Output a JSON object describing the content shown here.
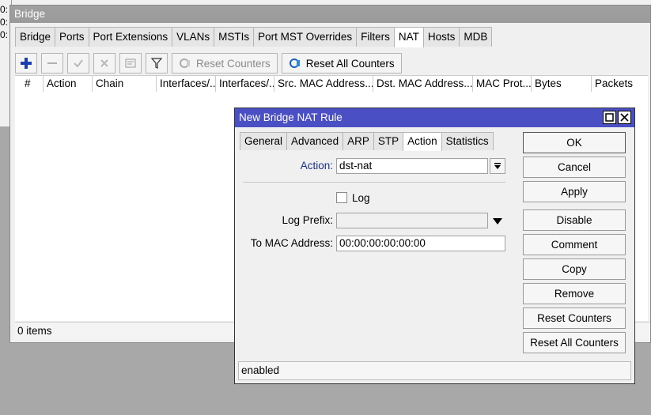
{
  "side_labels": [
    "0:",
    "0:",
    "0:"
  ],
  "bridge": {
    "title": "Bridge",
    "tabs": [
      {
        "label": "Bridge",
        "active": false
      },
      {
        "label": "Ports",
        "active": false
      },
      {
        "label": "Port Extensions",
        "active": false
      },
      {
        "label": "VLANs",
        "active": false
      },
      {
        "label": "MSTIs",
        "active": false
      },
      {
        "label": "Port MST Overrides",
        "active": false
      },
      {
        "label": "Filters",
        "active": false
      },
      {
        "label": "NAT",
        "active": true
      },
      {
        "label": "Hosts",
        "active": false
      },
      {
        "label": "MDB",
        "active": false
      }
    ],
    "toolbar": {
      "add_icon": "plus-icon",
      "remove_icon": "minus-icon",
      "enable_icon": "check-icon",
      "disable_icon": "x-icon",
      "comment_icon": "note-icon",
      "filter_icon": "filter-icon",
      "reset_counters_label": "Reset Counters",
      "reset_all_counters_label": "Reset All Counters"
    },
    "columns": [
      "#",
      "Action",
      "Chain",
      "Interfaces/...",
      "Interfaces/...",
      "Src. MAC Address...",
      "Dst. MAC Address...",
      "MAC Prot...",
      "Bytes",
      "Packets"
    ],
    "status": "0 items"
  },
  "dialog": {
    "title": "New Bridge NAT Rule",
    "tabs": [
      {
        "label": "General",
        "active": false
      },
      {
        "label": "Advanced",
        "active": false
      },
      {
        "label": "ARP",
        "active": false
      },
      {
        "label": "STP",
        "active": false
      },
      {
        "label": "Action",
        "active": true
      },
      {
        "label": "Statistics",
        "active": false
      }
    ],
    "fields": {
      "action_label": "Action:",
      "action_value": "dst-nat",
      "log_label": "Log",
      "log_checked": false,
      "log_prefix_label": "Log Prefix:",
      "log_prefix_value": "",
      "to_mac_label": "To MAC Address:",
      "to_mac_value": "00:00:00:00:00:00"
    },
    "buttons": {
      "ok": "OK",
      "cancel": "Cancel",
      "apply": "Apply",
      "disable": "Disable",
      "comment": "Comment",
      "copy": "Copy",
      "remove": "Remove",
      "reset_counters": "Reset Counters",
      "reset_all_counters": "Reset All Counters"
    },
    "status": "enabled"
  },
  "colors": {
    "dialog_title_bg": "#4a4fc4",
    "add_icon": "#1a3fb0"
  }
}
